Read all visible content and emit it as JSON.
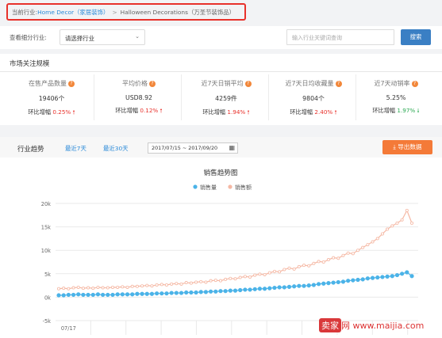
{
  "breadcrumb": {
    "prefix": "当前行业:",
    "level1": "Home Decor（家居装饰）",
    "separator": ">",
    "level2": "Halloween Decorations（万圣节装饰品）"
  },
  "filter": {
    "label": "查看细分行业:",
    "select_value": "请选择行业",
    "search_placeholder": "输入行业关键词查询",
    "search_button": "搜索"
  },
  "market": {
    "title": "市场关注规模",
    "metrics": [
      {
        "name": "在售产品数量",
        "value": "19406个",
        "change_label": "环比增幅",
        "change": "0.25%",
        "direction": "up"
      },
      {
        "name": "平均价格",
        "value": "USD8.92",
        "change_label": "环比增幅",
        "change": "0.12%",
        "direction": "up"
      },
      {
        "name": "近7天日销平均",
        "value": "4259件",
        "change_label": "环比增幅",
        "change": "1.94%",
        "direction": "up"
      },
      {
        "name": "近7天日均收藏量",
        "value": "9804个",
        "change_label": "环比增幅",
        "change": "2.40%",
        "direction": "up"
      },
      {
        "name": "近7天动销率",
        "value": "5.25%",
        "change_label": "环比增幅",
        "change": "1.97%",
        "direction": "down"
      }
    ]
  },
  "trend": {
    "title": "行业趋势",
    "tab1": "最近7天",
    "tab2": "最近30天",
    "date_range": "2017/07/15 ~ 2017/09/20",
    "export": "导出数据"
  },
  "watermark": {
    "logo": "卖家",
    "text": "网 www.maijia.com"
  },
  "colors": {
    "volume": "#4bb3e8",
    "amount": "#f5b8a4",
    "up": "#e8312b",
    "down": "#2aa952",
    "accent": "#2a8ad8"
  },
  "chart_data": {
    "type": "line",
    "title": "销售趋势图",
    "ylim": [
      -5000,
      20000
    ],
    "yticks": [
      "20k",
      "15k",
      "10k",
      "5k",
      "0k",
      "-5k"
    ],
    "yticks_values": [
      20000,
      15000,
      10000,
      5000,
      0,
      -5000
    ],
    "x_first_label": "07/17",
    "series": [
      {
        "name": "销售量",
        "values": [
          400,
          400,
          500,
          500,
          600,
          500,
          500,
          500,
          600,
          500,
          500,
          500,
          600,
          600,
          600,
          600,
          700,
          700,
          700,
          700,
          800,
          800,
          800,
          900,
          900,
          900,
          1000,
          1000,
          1000,
          1100,
          1100,
          1200,
          1200,
          1300,
          1300,
          1400,
          1400,
          1500,
          1600,
          1600,
          1700,
          1800,
          1800,
          1900,
          2000,
          2100,
          2100,
          2200,
          2300,
          2400,
          2400,
          2500,
          2600,
          2800,
          2900,
          3000,
          3100,
          3200,
          3300,
          3500,
          3600,
          3700,
          3800,
          4000,
          4100,
          4200,
          4300,
          4400,
          4500,
          4700,
          5000,
          5300,
          4500
        ]
      },
      {
        "name": "销售额",
        "values": [
          1800,
          1900,
          1800,
          2000,
          2100,
          1900,
          2000,
          1900,
          2100,
          2000,
          2000,
          2100,
          2100,
          2200,
          2100,
          2300,
          2300,
          2400,
          2500,
          2400,
          2600,
          2700,
          2600,
          2800,
          2900,
          2800,
          3100,
          3000,
          3200,
          3300,
          3200,
          3500,
          3600,
          3500,
          3800,
          4000,
          3900,
          4200,
          4400,
          4300,
          4700,
          4900,
          4800,
          5200,
          5500,
          5400,
          5900,
          6200,
          6000,
          6500,
          6800,
          6700,
          7200,
          7600,
          7500,
          8000,
          8400,
          8300,
          8900,
          9400,
          9300,
          10000,
          10600,
          11200,
          11800,
          12500,
          13500,
          14500,
          15200,
          15800,
          16500,
          18500,
          15800
        ]
      }
    ]
  }
}
